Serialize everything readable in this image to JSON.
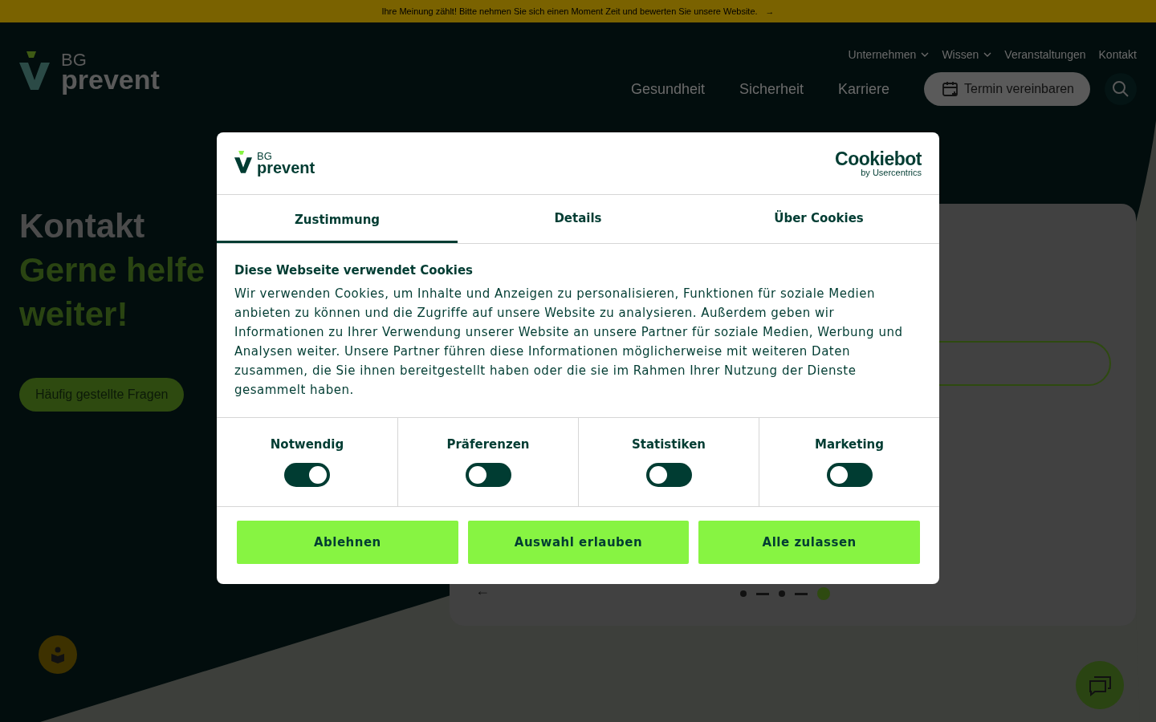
{
  "banner": {
    "text": "Ihre Meinung zählt! Bitte nehmen Sie sich einen Moment Zeit und bewerten Sie unsere Website.",
    "arrow": "→"
  },
  "header": {
    "logo": {
      "top": "BG",
      "bottom": "prevent"
    },
    "top_nav": [
      {
        "label": "Unternehmen",
        "dropdown": true
      },
      {
        "label": "Wissen",
        "dropdown": true
      },
      {
        "label": "Veranstaltungen",
        "dropdown": false
      },
      {
        "label": "Kontakt",
        "dropdown": false
      }
    ],
    "main_nav": [
      "Gesundheit",
      "Sicherheit",
      "Karriere"
    ],
    "appointment_button": "Termin vereinbaren"
  },
  "hero": {
    "title": "Kontakt",
    "subtitle_lines": [
      "Gerne helfe",
      "weiter!"
    ],
    "faq_button": "Häufig gestellte Fragen"
  },
  "card": {
    "back_arrow": "←",
    "carousel": [
      {
        "kind": "dot",
        "selected": false
      },
      {
        "kind": "dash",
        "selected": false
      },
      {
        "kind": "dot",
        "selected": false
      },
      {
        "kind": "dash",
        "selected": false
      },
      {
        "kind": "dot",
        "selected": true
      }
    ]
  },
  "cookie_dialog": {
    "logo": {
      "top": "BG",
      "bottom": "prevent"
    },
    "brand": {
      "name": "Cookiebot",
      "byline": "by Usercentrics"
    },
    "tabs": [
      {
        "label": "Zustimmung",
        "selected": true
      },
      {
        "label": "Details",
        "selected": false
      },
      {
        "label": "Über Cookies",
        "selected": false
      }
    ],
    "heading": "Diese Webseite verwendet Cookies",
    "body": "Wir verwenden Cookies, um Inhalte und Anzeigen zu personalisieren, Funktionen für soziale Medien anbieten zu können und die Zugriffe auf unsere Website zu analysieren. Außerdem geben wir Informationen zu Ihrer Verwendung unserer Website an unsere Partner für soziale Medien, Werbung und Analysen weiter. Unsere Partner führen diese Informationen möglicherweise mit weiteren Daten zusammen, die Sie ihnen bereitgestellt haben oder die sie im Rahmen Ihrer Nutzung der Dienste gesammelt haben.",
    "toggles": [
      {
        "label": "Notwendig",
        "on": true
      },
      {
        "label": "Präferenzen",
        "on": false
      },
      {
        "label": "Statistiken",
        "on": false
      },
      {
        "label": "Marketing",
        "on": false
      }
    ],
    "buttons": [
      "Ablehnen",
      "Auswahl erlauben",
      "Alle zulassen"
    ]
  }
}
